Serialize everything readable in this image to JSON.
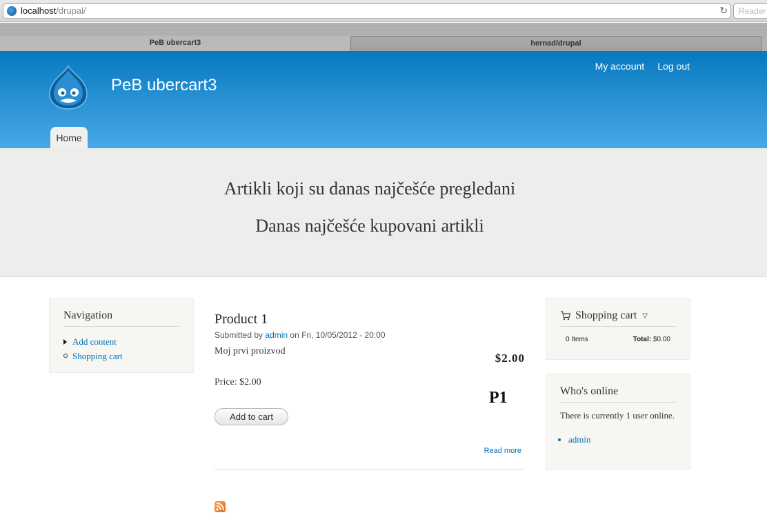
{
  "browser": {
    "url_host": "localhost",
    "url_path": "/drupal/",
    "reader_label": "Reader",
    "tabs": [
      {
        "label": "PeB ubercart3"
      },
      {
        "label": "hernad/drupal"
      }
    ]
  },
  "header": {
    "site_name": "PeB ubercart3",
    "secondary_menu": [
      {
        "label": "My account"
      },
      {
        "label": "Log out"
      }
    ],
    "main_menu": [
      {
        "label": "Home"
      }
    ]
  },
  "featured": {
    "line1": "Artikli koji su danas najčešće pregledani",
    "line2": "Danas najčešće kupovani artikli"
  },
  "navigation": {
    "title": "Navigation",
    "items": [
      {
        "label": "Add content"
      },
      {
        "label": "Shopping cart"
      }
    ]
  },
  "node": {
    "title": "Product 1",
    "submitted_prefix": "Submitted by",
    "author": "admin",
    "submitted_suffix": "on Fri, 10/05/2012 - 20:00",
    "body": "Moj prvi proizvod",
    "display_price": "$2.00",
    "sell_price": "Price: $2.00",
    "sku": "P1",
    "add_to_cart": "Add to cart",
    "read_more": "Read more"
  },
  "cart": {
    "title": "Shopping cart",
    "items": "0 Items",
    "total_label": "Total:",
    "total_value": "$0.00"
  },
  "online": {
    "title": "Who's online",
    "text": "There is currently 1 user online.",
    "users": [
      {
        "name": "admin"
      }
    ]
  },
  "colors": {
    "header_top": "#0779bf",
    "header_bottom": "#48a9e6",
    "link": "#0071b3"
  }
}
